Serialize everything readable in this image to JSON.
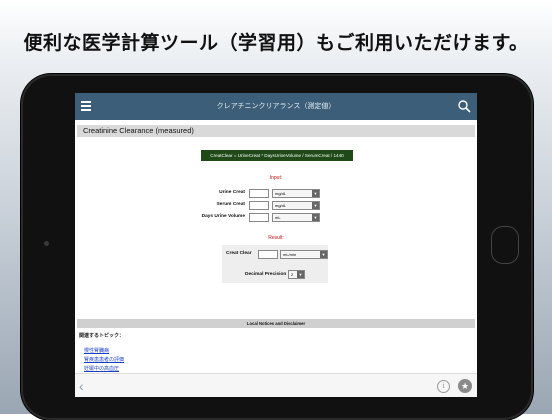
{
  "headline": "便利な医学計算ツール（学習用）もご利用いただけます。",
  "navbar": {
    "title": "クレアチニンクリアランス（測定値）",
    "menu_icon": "hamburger-menu-icon",
    "search_icon": "search-icon"
  },
  "calculator": {
    "title": "Creatinine Clearance (measured)",
    "formula": "CreatClear = UrineCreat * DaysUrineVolume / SerumCreat / 1440",
    "input_heading": "Input:",
    "inputs": [
      {
        "label": "Urine Creat",
        "value": "",
        "unit": "mg/dL"
      },
      {
        "label": "Serum Creat",
        "value": "",
        "unit": "mg/dL"
      },
      {
        "label": "Days Urine Volume",
        "value": "",
        "unit": "mL"
      }
    ],
    "result_heading": "Result:",
    "result": {
      "label": "Creat Clear",
      "value": "",
      "unit": "mL/min"
    },
    "decimal": {
      "label": "Decimal Precision",
      "value": "2"
    }
  },
  "legal": "Local Notices and Disclaimer",
  "topics": {
    "heading": "関連するトピック：",
    "links": [
      "慢性腎臓病",
      "腎疾患患者の評価",
      "妊娠中の高血圧"
    ]
  },
  "colors": {
    "navbar": "#3c5e78",
    "formula_bg": "#1f4a18",
    "heading_red": "#cc1111",
    "link_blue": "#1a3fc4"
  }
}
